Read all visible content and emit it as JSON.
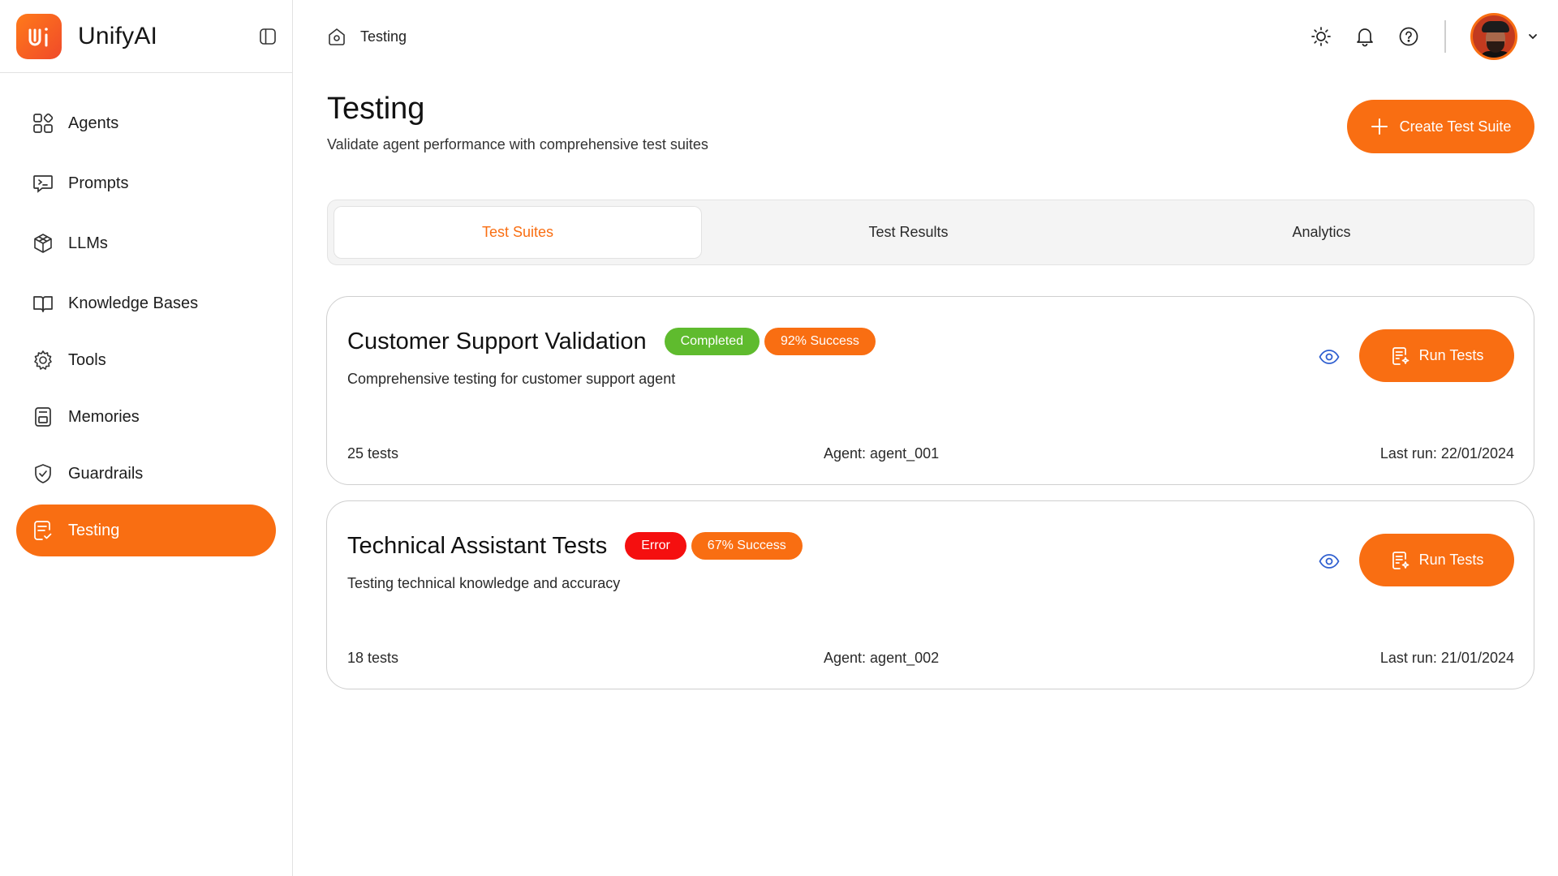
{
  "app": {
    "name": "UnifyAI"
  },
  "sidebar": {
    "items": [
      {
        "label": "Agents",
        "icon": "agents-grid-icon"
      },
      {
        "label": "Prompts",
        "icon": "terminal-prompt-icon"
      },
      {
        "label": "LLMs",
        "icon": "llm-cube-icon"
      },
      {
        "label": "Knowledge Bases",
        "icon": "book-icon"
      },
      {
        "label": "Tools",
        "icon": "tools-gear-icon"
      },
      {
        "label": "Memories",
        "icon": "memory-card-icon"
      },
      {
        "label": "Guardrails",
        "icon": "shield-check-icon"
      },
      {
        "label": "Testing",
        "icon": "testing-doc-icon",
        "active": true
      }
    ]
  },
  "topbar": {
    "breadcrumb": "Testing"
  },
  "header": {
    "title": "Testing",
    "subtitle": "Validate agent performance with comprehensive test suites",
    "create_label": "Create Test Suite"
  },
  "tabs": [
    {
      "label": "Test Suites",
      "active": true
    },
    {
      "label": "Test Results"
    },
    {
      "label": "Analytics"
    }
  ],
  "suites": [
    {
      "title": "Customer Support Validation",
      "status": "Completed",
      "status_color": "#5fbb2e",
      "success": "92% Success",
      "description": "Comprehensive testing for customer support agent",
      "tests": "25 tests",
      "agent": "Agent: agent_001",
      "last_run": "Last run: 22/01/2024",
      "run_label": "Run Tests"
    },
    {
      "title": "Technical Assistant Tests",
      "status": "Error",
      "status_color": "#f50f0f",
      "success": "67% Success",
      "description": "Testing technical knowledge and accuracy",
      "tests": "18 tests",
      "agent": "Agent: agent_002",
      "last_run": "Last run: 21/01/2024",
      "run_label": "Run Tests"
    }
  ],
  "colors": {
    "accent": "#f96e12",
    "success": "#5fbb2e",
    "error": "#f50f0f"
  }
}
